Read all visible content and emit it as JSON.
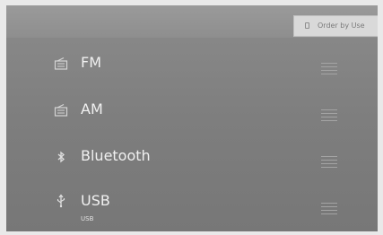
{
  "header": {
    "sort_button": {
      "label": "Order by Use",
      "icon": "sort-icon"
    }
  },
  "sources": [
    {
      "label": "FM",
      "icon": "radio-icon",
      "sublabel": ""
    },
    {
      "label": "AM",
      "icon": "radio-icon",
      "sublabel": ""
    },
    {
      "label": "Bluetooth",
      "icon": "bluetooth-icon",
      "sublabel": ""
    },
    {
      "label": "USB",
      "icon": "usb-icon",
      "sublabel": "USB"
    }
  ],
  "colors": {
    "background": "#808080",
    "text": "#f0f0f0",
    "sort_button_bg": "#d9d9d9"
  }
}
